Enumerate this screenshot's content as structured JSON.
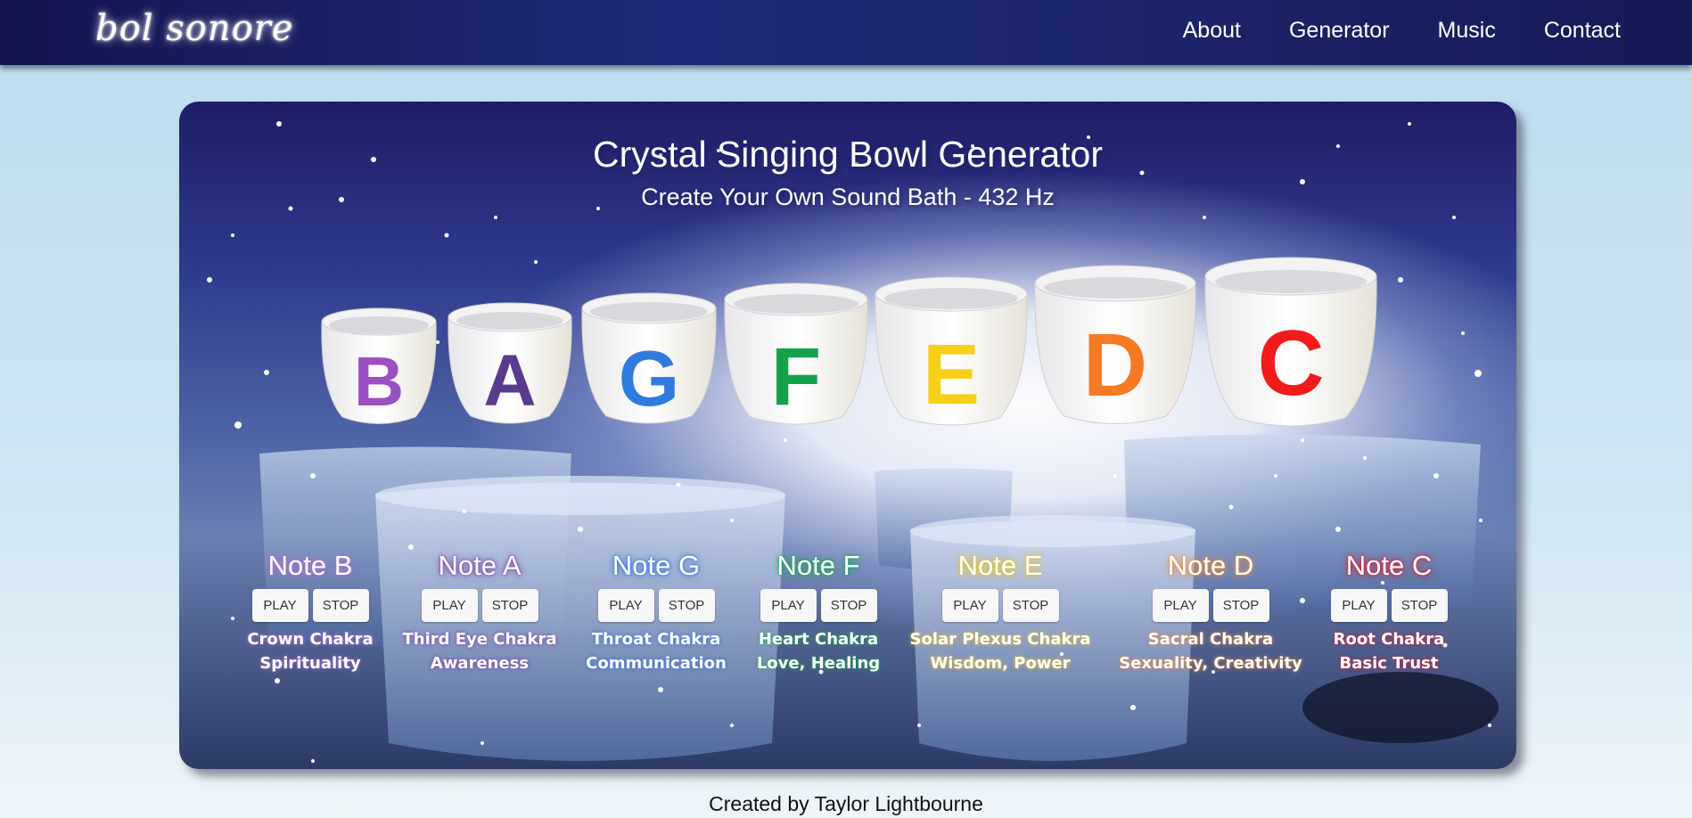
{
  "nav": {
    "brand": "bol sonore",
    "links": [
      "About",
      "Generator",
      "Music",
      "Contact"
    ]
  },
  "generator": {
    "title": "Crystal Singing Bowl Generator",
    "subtitle": "Create Your Own Sound Bath - 432 Hz",
    "bowls": [
      {
        "letter": "B",
        "color": "#9b4fc0"
      },
      {
        "letter": "A",
        "color": "#5a3a8e"
      },
      {
        "letter": "G",
        "color": "#2f7be0"
      },
      {
        "letter": "F",
        "color": "#12a34a"
      },
      {
        "letter": "E",
        "color": "#f7cf18"
      },
      {
        "letter": "D",
        "color": "#f57a22"
      },
      {
        "letter": "C",
        "color": "#f21a1a"
      }
    ],
    "notes": [
      {
        "title": "Note B",
        "play": "PLAY",
        "stop": "STOP",
        "chakra": "Crown Chakra",
        "meaning": "Spirituality",
        "glow": "#b06cd6"
      },
      {
        "title": "Note A",
        "play": "PLAY",
        "stop": "STOP",
        "chakra": "Third Eye Chakra",
        "meaning": "Awareness",
        "glow": "#7a3aa8"
      },
      {
        "title": "Note G",
        "play": "PLAY",
        "stop": "STOP",
        "chakra": "Throat Chakra",
        "meaning": "Communication",
        "glow": "#2f6fd8"
      },
      {
        "title": "Note F",
        "play": "PLAY",
        "stop": "STOP",
        "chakra": "Heart Chakra",
        "meaning": "Love, Healing",
        "glow": "#13a84a"
      },
      {
        "title": "Note E",
        "play": "PLAY",
        "stop": "STOP",
        "chakra": "Solar Plexus Chakra",
        "meaning": "Wisdom, Power",
        "glow": "#e8c212"
      },
      {
        "title": "Note D",
        "play": "PLAY",
        "stop": "STOP",
        "chakra": "Sacral Chakra",
        "meaning": "Sexuality, Creativity",
        "glow": "#f08a2a"
      },
      {
        "title": "Note C",
        "play": "PLAY",
        "stop": "STOP",
        "chakra": "Root Chakra",
        "meaning": "Basic Trust",
        "glow": "#e0152a"
      }
    ]
  },
  "footer": {
    "credit": "Created by Taylor Lightbourne"
  }
}
